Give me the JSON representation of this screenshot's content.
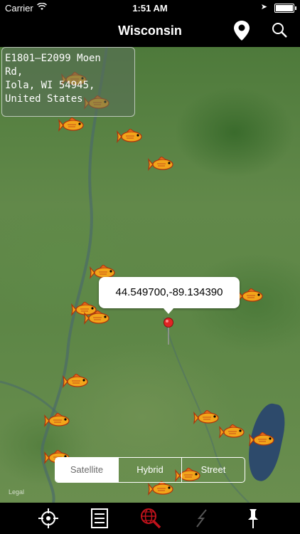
{
  "status_bar": {
    "carrier": "Carrier",
    "time": "1:51 AM"
  },
  "nav": {
    "title": "Wisconsin",
    "pin_icon": "map-pin-icon",
    "search_icon": "search-icon"
  },
  "map": {
    "address_lines": [
      "E1801–E2099 Moen",
      "Rd,",
      "Iola, WI  54945,",
      "United States"
    ],
    "callout_text": "44.549700,-89.134390",
    "marker_icon": "fish-marker-icon",
    "legal": "Legal"
  },
  "map_type": {
    "options": [
      "Satellite",
      "Hybrid",
      "Street"
    ],
    "selected": "Satellite"
  },
  "tab_bar": {
    "tabs": [
      {
        "icon": "crosshair-icon",
        "active": false
      },
      {
        "icon": "list-icon",
        "active": false
      },
      {
        "icon": "globe-search-icon",
        "active": true
      },
      {
        "icon": "lightning-icon",
        "active": false
      },
      {
        "icon": "pushpin-icon",
        "active": false
      }
    ]
  },
  "colors": {
    "active_tab": "#c0121b",
    "fish_body": "#f2a51a",
    "pin_red": "#e02424"
  }
}
